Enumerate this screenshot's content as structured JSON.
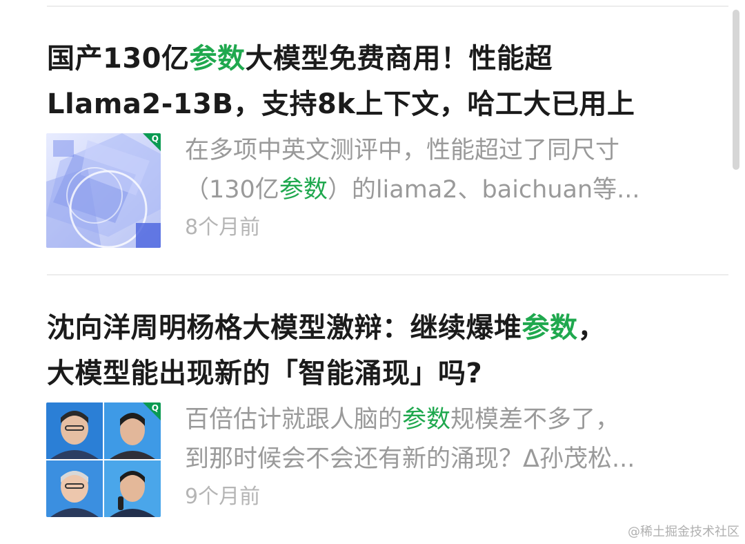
{
  "articles": [
    {
      "title_parts": [
        "国产130亿",
        "参数",
        "大模型免费商用！性能超",
        "Llama2-13B，支持8k上下文，哈工大已用上"
      ],
      "snippet_parts": [
        "在多项中英文测评中，性能超过了同尺寸",
        "（130亿",
        "参数",
        "）的liama2、baichuan等..."
      ],
      "time": "8个月前",
      "thumb_icon": "abstract-blue-geometric-image"
    },
    {
      "title_parts": [
        "沈向洋周明杨格大模型激辩：继续爆堆",
        "参数",
        "，",
        "大模型能出现新的「智能涌现」吗?"
      ],
      "snippet_parts": [
        "百倍估计就跟人脑的",
        "参数",
        "规模差不多了，",
        "到那时候会不会还有新的涌现？Δ孙茂松..."
      ],
      "time": "9个月前",
      "thumb_icon": "four-speakers-portrait-grid"
    }
  ],
  "corner_badge": "Q",
  "watermark": "@稀土掘金技术社区",
  "colors": {
    "highlight": "#1fa84e",
    "title": "#1b1b1b",
    "snippet": "#9a9a9a",
    "time": "#b5b5b5"
  }
}
